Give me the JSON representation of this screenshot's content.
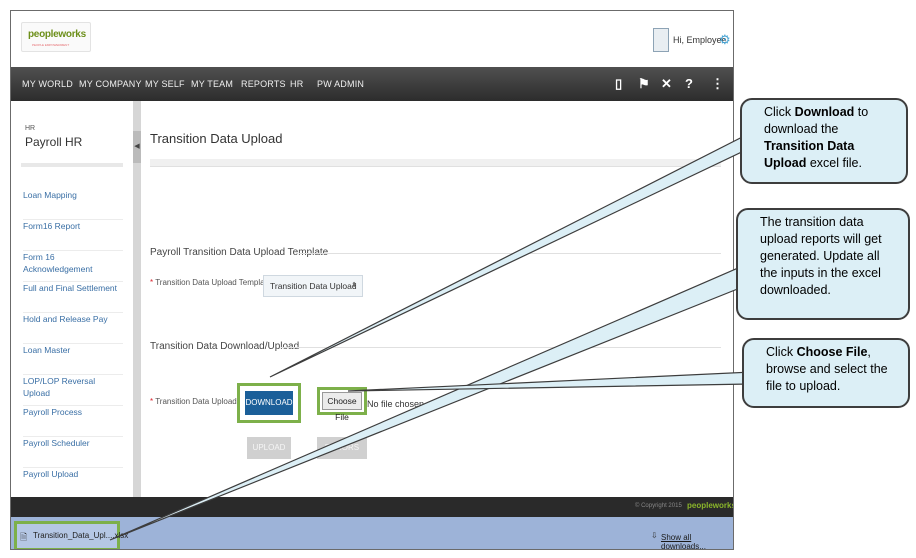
{
  "header": {
    "logo": "peopleworks",
    "logo_tagline": "PEOPLE EMPOWERMENT",
    "greeting": "Hi, Employee",
    "gear_icon": "gear-icon"
  },
  "nav": {
    "items": [
      "MY WORLD",
      "MY COMPANY",
      "MY SELF",
      "MY TEAM",
      "REPORTS",
      "HR",
      "PW ADMIN"
    ],
    "icons": [
      "book-icon",
      "flag-icon",
      "tools-icon",
      "help-icon",
      "share-icon"
    ]
  },
  "sidebar": {
    "small_label": "HR",
    "title": "Payroll HR",
    "items": [
      "Loan Mapping",
      "Form16 Report",
      "Form 16 Acknowledgement",
      "Full and Final Settlement",
      "Hold and Release Pay",
      "Loan Master",
      "LOP/LOP Reversal Upload",
      "Payroll Process",
      "Payroll Scheduler",
      "Payroll Upload"
    ]
  },
  "main": {
    "page_title": "Transition Data Upload",
    "section1_title": "Payroll Transition Data Upload Template",
    "template_label": "Transition Data Upload Template",
    "template_selected": "Transition Data Upload",
    "section2_title": "Transition Data Download/Upload",
    "upload_label": "Transition Data Upload",
    "download_button": "DOWNLOAD",
    "choose_file_button": "Choose File",
    "no_file_text": "No file chosen",
    "upload_button": "UPLOAD",
    "errors_button": "ERRORS"
  },
  "footer": {
    "copyright": "© Copyright 2015",
    "logo": "peopleworks"
  },
  "download_bar": {
    "file_name": "Transition_Data_Upl....xlsx",
    "show_all": "Show all downloads..."
  },
  "callouts": {
    "c1_pre": "Click ",
    "c1_b1": "Download",
    "c1_mid": " to download the ",
    "c1_b2": "Transition Data Upload",
    "c1_post": " excel file.",
    "c2": "The transition data upload reports will get generated. Update all the inputs in the excel downloaded.",
    "c3_pre": "Click ",
    "c3_b": "Choose File",
    "c3_post": ", browse and select the file to upload."
  },
  "colors": {
    "nav_bg": "#3a3a3a",
    "link": "#3a6fa5",
    "download_button": "#1b5f99",
    "highlight_border": "#7db04a",
    "callout_bg": "#dceff6",
    "download_bar": "#9db3d8"
  }
}
